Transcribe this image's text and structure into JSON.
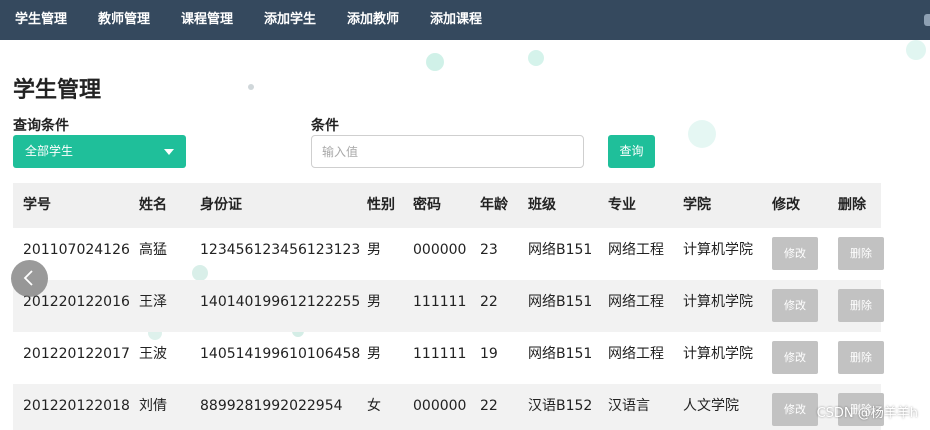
{
  "nav": {
    "items": [
      "学生管理",
      "教师管理",
      "课程管理",
      "添加学生",
      "添加教师",
      "添加课程"
    ]
  },
  "page": {
    "title": "学生管理"
  },
  "filter": {
    "condition_label": "查询条件",
    "select_value": "全部学生",
    "keyword_label": "条件",
    "input_placeholder": "输入值",
    "query_button": "查询"
  },
  "table": {
    "headers": [
      "学号",
      "姓名",
      "身份证",
      "性别",
      "密码",
      "年龄",
      "班级",
      "专业",
      "学院",
      "修改",
      "删除"
    ],
    "rows": [
      [
        "201107024126",
        "高猛",
        "123456123456123123",
        "男",
        "000000",
        "23",
        "网络B151",
        "网络工程",
        "计算机学院"
      ],
      [
        "201220122016",
        "王泽",
        "140140199612122255",
        "男",
        "111111",
        "22",
        "网络B151",
        "网络工程",
        "计算机学院"
      ],
      [
        "201220122017",
        "王波",
        "140514199610106458",
        "男",
        "111111",
        "19",
        "网络B151",
        "网络工程",
        "计算机学院"
      ],
      [
        "201220122018",
        "刘倩",
        "8899281992022954",
        "女",
        "000000",
        "22",
        "汉语B152",
        "汉语言",
        "人文学院"
      ]
    ],
    "edit_label": "修改",
    "delete_label": "删除"
  },
  "watermark": "CSDN @杨羊羊h",
  "colors": {
    "nav_bg": "#35495e",
    "accent": "#1fbf9a",
    "action_button": "#c2c2c2"
  }
}
